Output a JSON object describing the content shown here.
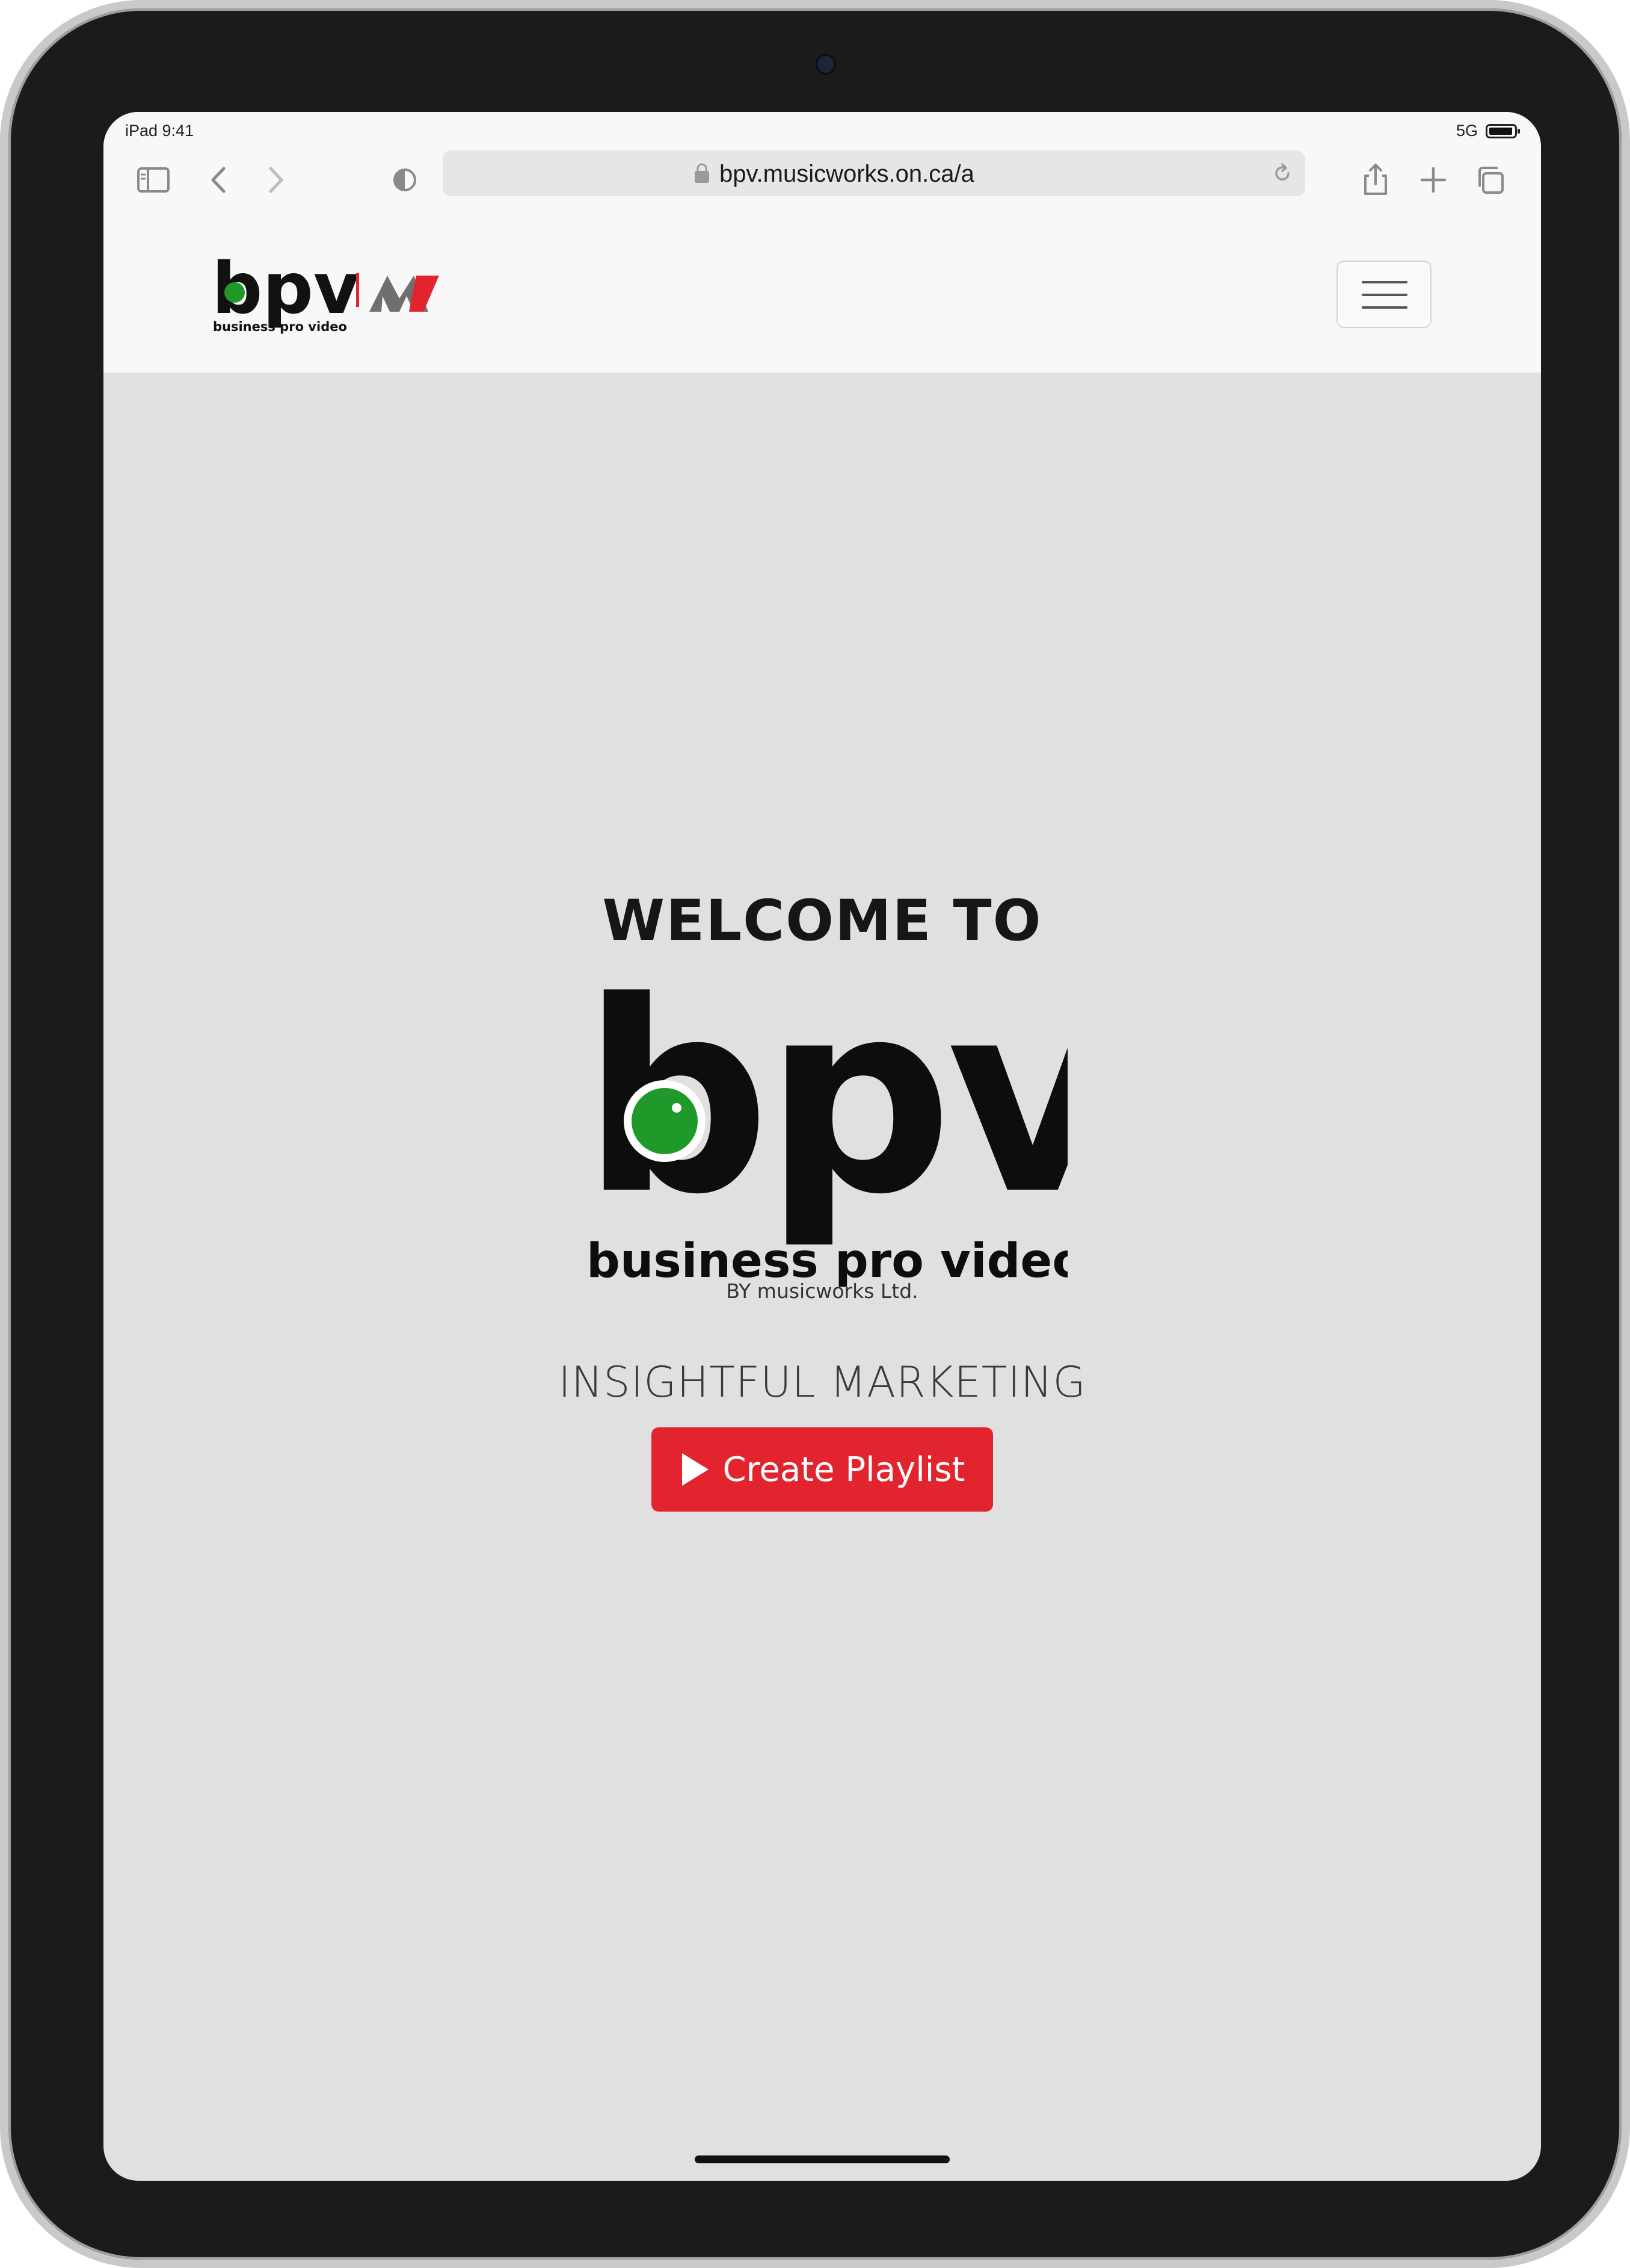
{
  "status_bar": {
    "time": "iPad 9:41",
    "signal": "5G"
  },
  "browser": {
    "url": "bpv.musicworks.on.ca/a"
  },
  "header": {
    "brand_wordmark": "bpv",
    "brand_tagline": "business pro video",
    "partner_mark": "MW"
  },
  "hero": {
    "welcome": "WELCOME TO",
    "logo_wordmark": "bpv",
    "logo_tagline": "business pro video",
    "byline": "BY musicworks Ltd.",
    "tagline": "INSIGHTFUL MARKETING",
    "cta_label": "Create Playlist"
  },
  "colors": {
    "accent_red": "#e1242e",
    "brand_green": "#1f9a2a",
    "page_bg": "#e0e0e0",
    "navbar_bg": "#f8f8f8"
  },
  "icons": [
    "sidebar-icon",
    "back-icon",
    "forward-icon",
    "reader-icon",
    "lock-icon",
    "reload-icon",
    "share-icon",
    "new-tab-icon",
    "tabs-icon",
    "menu-icon",
    "play-icon"
  ]
}
